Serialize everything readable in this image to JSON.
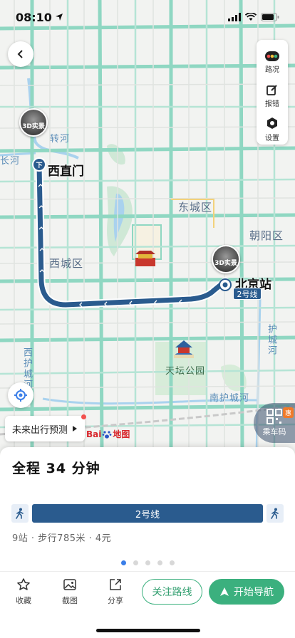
{
  "status_bar": {
    "time": "08:10"
  },
  "map": {
    "labels": {
      "xizhimen": "西直门",
      "beijing_station": "北京站",
      "dongcheng": "东城区",
      "xicheng": "西城区",
      "chaoyang": "朝阳区",
      "tiantan": "天坛公园",
      "nanhu_river": "南护城河",
      "xihu_river": "西护城河",
      "hucheng_east": "护城河",
      "zhuanhe": "转河",
      "changhe": "长河"
    },
    "pano_label": "3D实景",
    "line_badge": "2号线",
    "subway_icon": "下"
  },
  "tools": {
    "traffic": "路况",
    "report": "报错",
    "settings": "设置"
  },
  "forecast": {
    "label": "未来出行预测"
  },
  "logo": {
    "baidu": "Bai",
    "map": "地图"
  },
  "ride_code": {
    "label": "乘车码",
    "badge": "惠"
  },
  "sheet": {
    "title": "全程 34 分钟",
    "line_name": "2号线",
    "summary": "9站 · 步行785米 · 4元"
  },
  "actions": {
    "collect": "收藏",
    "screenshot": "截图",
    "share": "分享",
    "follow": "关注路线",
    "navigate": "开始导航"
  },
  "colors": {
    "route": "#2a5b8e",
    "accent": "#3bb07e",
    "road": "#8fd7c2"
  }
}
